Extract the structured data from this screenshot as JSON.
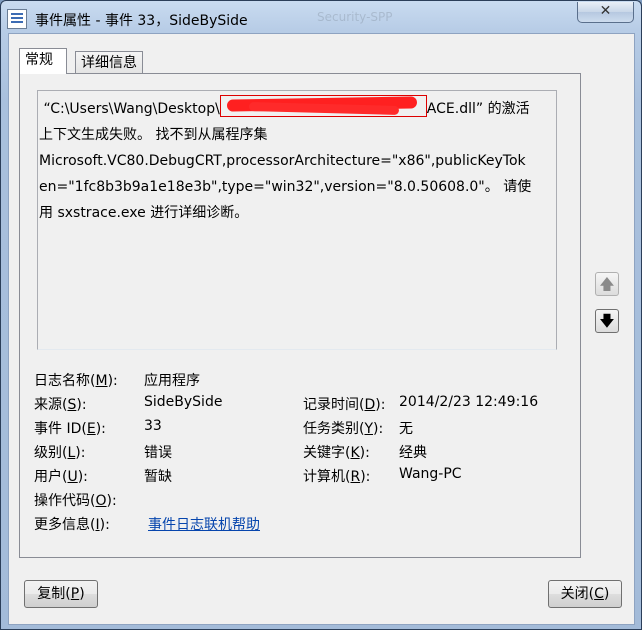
{
  "window": {
    "title": "事件属性 - 事件 33，SideBySide",
    "background_title": "Security-SPP",
    "close_glyph": "✕"
  },
  "tabs": [
    {
      "label": "常规",
      "active": true
    },
    {
      "label": "详细信息",
      "active": false
    }
  ],
  "message": {
    "line1_prefix": "“C:\\Users\\Wang\\Desktop\\",
    "line1_suffix": "ACE.dll” 的激活",
    "line2": "上下文生成失败。 找不到从属程序集",
    "line3": "Microsoft.VC80.DebugCRT,processorArchitecture=\"x86\",publicKeyTok",
    "line4": "en=\"1fc8b3b9a1e18e3b\",type=\"win32\",version=\"8.0.50608.0\"。 请使",
    "line5": "用 sxstrace.exe 进行详细诊断。"
  },
  "scroll": {
    "up_glyph": "🡅",
    "down_glyph": "🡇"
  },
  "fields": {
    "log_name": {
      "label": "日志名称(",
      "key": "M",
      "label_end": "):",
      "value": "应用程序"
    },
    "source": {
      "label": "来源(",
      "key": "S",
      "label_end": "):",
      "value": "SideBySide"
    },
    "logged": {
      "label": "记录时间(",
      "key": "D",
      "label_end": "):",
      "value": "2014/2/23 12:49:16"
    },
    "event_id": {
      "label": "事件 ID(",
      "key": "E",
      "label_end": "):",
      "value": "33"
    },
    "task_category": {
      "label": "任务类别(",
      "key": "Y",
      "label_end": "):",
      "value": "无"
    },
    "level": {
      "label": "级别(",
      "key": "L",
      "label_end": "):",
      "value": "错误"
    },
    "keywords": {
      "label": "关键字(",
      "key": "K",
      "label_end": "):",
      "value": "经典"
    },
    "user": {
      "label": "用户(",
      "key": "U",
      "label_end": "):",
      "value": "暂缺"
    },
    "computer": {
      "label": "计算机(",
      "key": "R",
      "label_end": "):",
      "value": "Wang-PC"
    },
    "opcode": {
      "label": "操作代码(",
      "key": "O",
      "label_end": "):",
      "value": ""
    },
    "more_info": {
      "label": "更多信息(",
      "key": "I",
      "label_end": "):",
      "value": "事件日志联机帮助"
    }
  },
  "buttons": {
    "copy": {
      "label": "复制(",
      "key": "P",
      "label_end": ")"
    },
    "close": {
      "label": "关闭(",
      "key": "C",
      "label_end": ")"
    }
  }
}
